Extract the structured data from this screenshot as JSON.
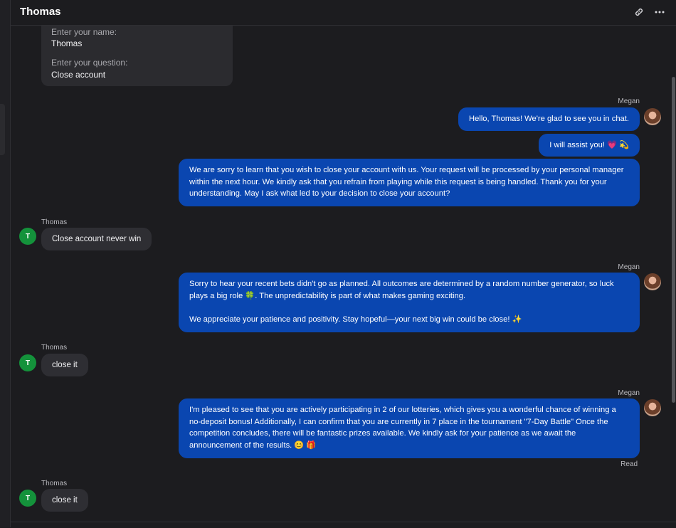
{
  "header": {
    "title": "Thomas",
    "link_icon": "link-icon",
    "more_icon": "more-icon"
  },
  "form": {
    "name_label": "Enter your name:",
    "name_value": "Thomas",
    "question_label": "Enter your question:",
    "question_value": "Close account"
  },
  "user": {
    "name": "Thomas",
    "initial": "T"
  },
  "agent": {
    "name": "Megan"
  },
  "messages": {
    "m1": "Hello, Thomas! We're glad to see you in chat.",
    "m2": "I will assist you! 💗 💫",
    "m3": "We are sorry to learn that you wish to close your account with us. Your request will be processed by your personal manager within the next hour. We kindly ask that you refrain from playing while this request is being handled. Thank you for your understanding. May I ask what led to your decision to close your account?",
    "u1": "Close account never win",
    "m4_p1": "Sorry to hear your recent bets didn't go as planned. All outcomes are determined by a random number generator, so luck plays a big role 🍀. The unpredictability is part of what makes gaming exciting.",
    "m4_p2": "We appreciate your patience and positivity. Stay hopeful—your next big win could be close! ✨",
    "u2": "close it",
    "m5": "I'm pleased to see that you are actively participating in 2 of our lotteries, which gives you a wonderful chance of winning a no-deposit bonus! Additionally, I can confirm that you are currently in 7 place in the tournament \"7-Day Battle\" Once the competition concludes, there will be fantastic prizes available. We kindly ask for your patience as we await the announcement of the results. 😊 🎁",
    "read_status": "Read",
    "u3": "close it"
  },
  "colors": {
    "background": "#1c1c1f",
    "agent_bubble": "#0a46b0",
    "user_bubble": "#2e2e33",
    "user_avatar": "#14923b"
  }
}
